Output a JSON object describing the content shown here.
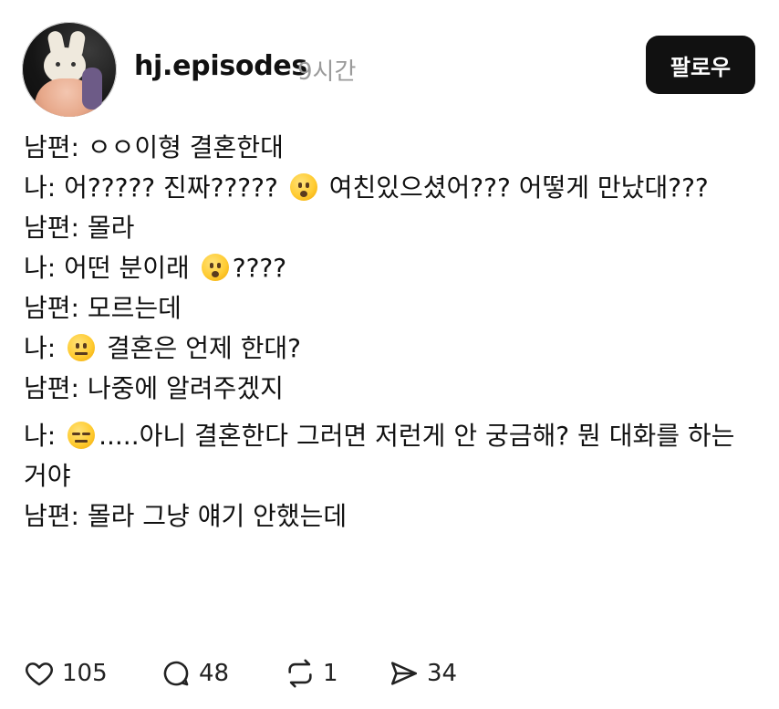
{
  "post": {
    "username": "hj.episodes",
    "time": "9시간",
    "follow_label": "팔로우",
    "lines": [
      {
        "before": "남편: ㅇㅇ이형 결혼한대"
      },
      {
        "before": "나: 어????? 진짜?????",
        "emoji": "hushed-face-emoji",
        "after": " 여친있으셨어??? 어떻게 만났대???"
      },
      {
        "before": "남편: 몰라"
      },
      {
        "before": "나: 어떤 분이래 ",
        "emoji": "hushed-face-emoji",
        "after": "????"
      },
      {
        "before": "남편: 모르는데"
      },
      {
        "before": "나: ",
        "emoji": "neutral-face-emoji",
        "after": " 결혼은 언제 한대?"
      },
      {
        "before": "남편: 나중에 알려주겠지"
      },
      {
        "before": "나: ",
        "emoji": "expressionless-face-emoji",
        "after": ".....아니 결혼한다 그러면 저런게 안 궁금해? 뭔 대화를 하는거야"
      },
      {
        "before": "남편: 몰라 그냥 얘기 안했는데"
      }
    ]
  },
  "actions": {
    "likes": "105",
    "comments": "48",
    "reposts": "1",
    "shares": "34"
  },
  "icons": {
    "like": "heart-icon",
    "comment": "comment-bubble-icon",
    "repost": "repost-icon",
    "share": "send-icon"
  }
}
